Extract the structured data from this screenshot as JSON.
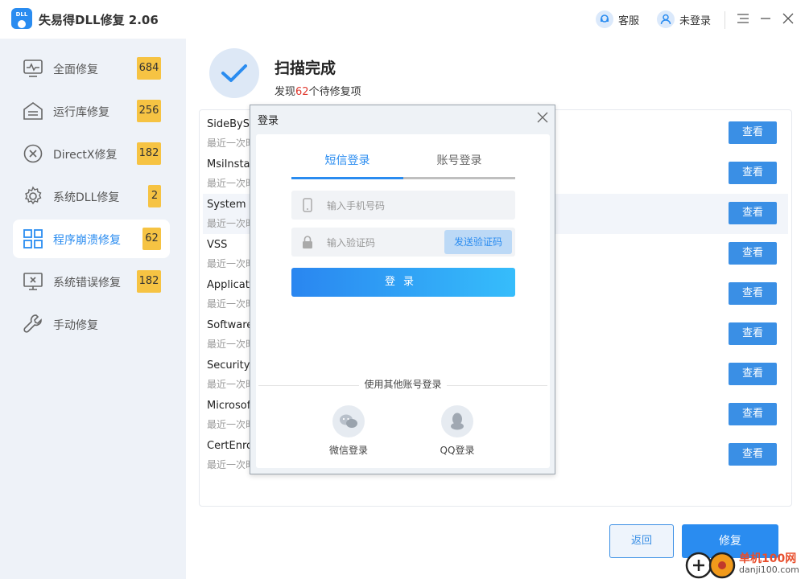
{
  "app": {
    "logo_text": "DLL",
    "title": "失易得DLL修复  2.06"
  },
  "titlebar": {
    "service_label": "客服",
    "login_status_label": "未登录"
  },
  "sidebar": {
    "items": [
      {
        "label": "全面修复",
        "count": "684",
        "icon": "activity-monitor-icon",
        "active": false
      },
      {
        "label": "运行库修复",
        "count": "256",
        "icon": "library-icon",
        "active": false
      },
      {
        "label": "DirectX修复",
        "count": "182",
        "icon": "x-circle-icon",
        "active": false
      },
      {
        "label": "系统DLL修复",
        "count": "2",
        "icon": "gear-icon",
        "active": false
      },
      {
        "label": "程序崩溃修复",
        "count": "62",
        "icon": "grid-icon",
        "active": true
      },
      {
        "label": "系统错误修复",
        "count": "182",
        "icon": "monitor-x-icon",
        "active": false
      },
      {
        "label": "手动修复",
        "count": "",
        "icon": "wrench-icon",
        "active": false
      }
    ]
  },
  "scan": {
    "title": "扫描完成",
    "prefix": "发现",
    "count": "62",
    "suffix": "个待修复项"
  },
  "list": {
    "view_label": "查看",
    "rows": [
      {
        "name": "SideBySide",
        "sub": "最近一次时间"
      },
      {
        "name": "MsiInstaller",
        "sub": "最近一次时间"
      },
      {
        "name": "System Restore",
        "sub": "最近一次时间"
      },
      {
        "name": "VSS",
        "sub": "最近一次时间"
      },
      {
        "name": "Application Error",
        "sub": "最近一次时间"
      },
      {
        "name": "Software Protection",
        "sub": "最近一次时间"
      },
      {
        "name": "SecurityCenter",
        "sub": "最近一次时间"
      },
      {
        "name": "Microsoft",
        "sub": "最近一次时间"
      },
      {
        "name": "CertEnroll",
        "sub": "最近一次时间"
      }
    ]
  },
  "buttons": {
    "back": "返回",
    "fix": "修复"
  },
  "watermark": {
    "site": "单机100网",
    "domain": "danji100.com"
  },
  "login_modal": {
    "title": "登录",
    "tab_sms": "短信登录",
    "tab_account": "账号登录",
    "phone_placeholder": "输入手机号码",
    "code_placeholder": "输入验证码",
    "send_code": "发送验证码",
    "login": "登录",
    "other_login": "使用其他账号登录",
    "wechat": "微信登录",
    "qq": "QQ登录"
  },
  "colors": {
    "accent": "#2a8cf0",
    "badge": "#f6c343",
    "count_red": "#e0392f"
  }
}
